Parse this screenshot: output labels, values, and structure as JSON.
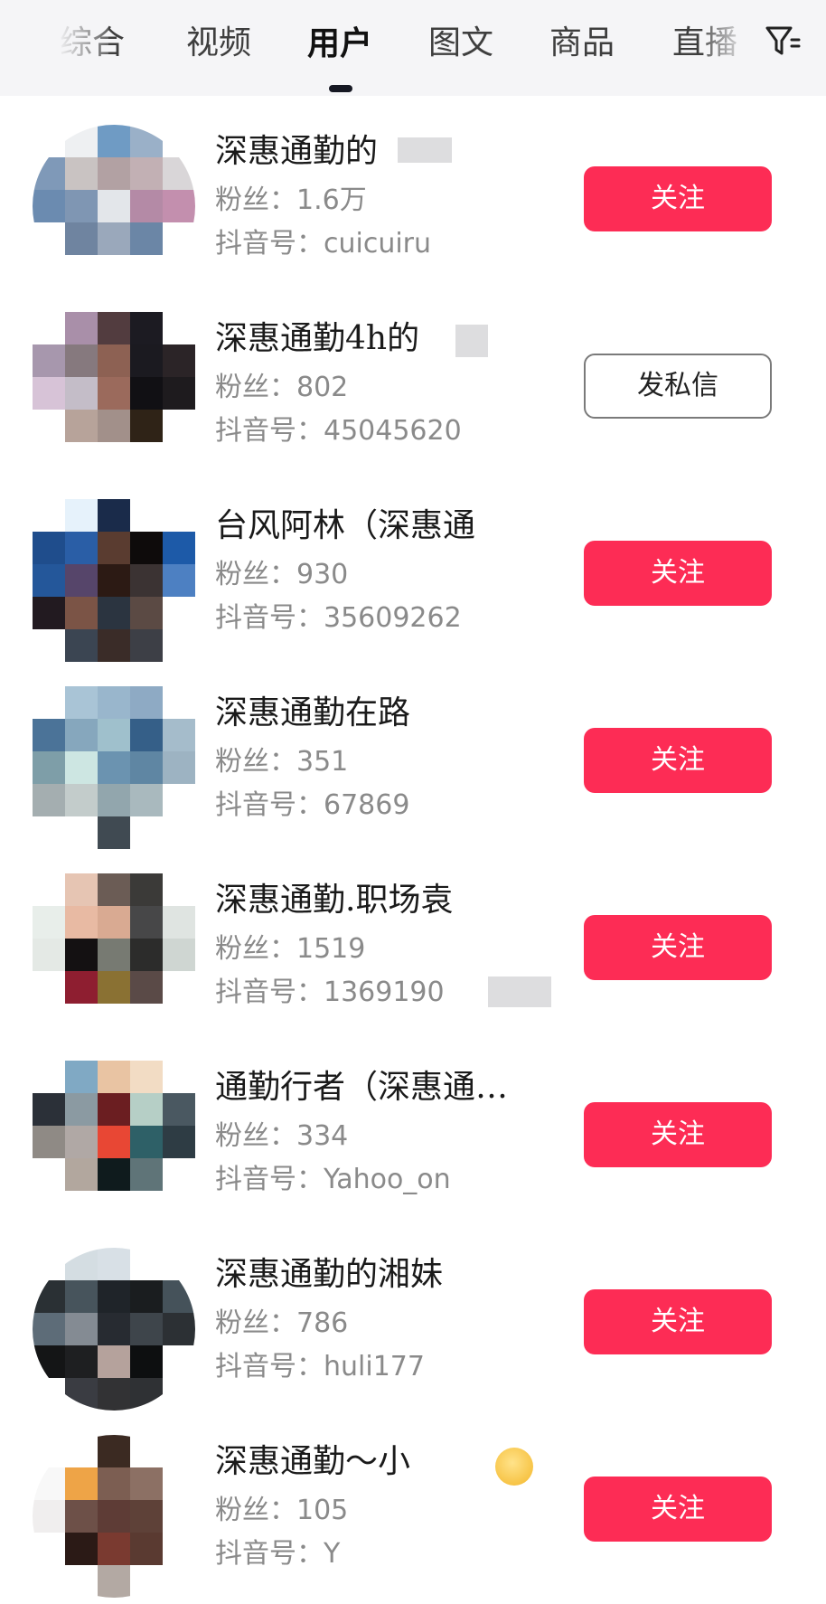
{
  "tabs": [
    {
      "label": "综合",
      "active": false
    },
    {
      "label": "视频",
      "active": false
    },
    {
      "label": "用户",
      "active": true
    },
    {
      "label": "图文",
      "active": false
    },
    {
      "label": "商品",
      "active": false
    },
    {
      "label": "直播",
      "active": false
    }
  ],
  "filter_icon": "filter-icon",
  "colors": {
    "follow_button": "#fd2c55",
    "topbar_bg": "#f5f5f7",
    "meta_text": "#8a8a8a"
  },
  "fans_label": "粉丝：",
  "douyin_label": "抖音号：",
  "users": [
    {
      "name": "深惠通勤的",
      "fans": "1.6万",
      "douyin_id": "cuicuiru",
      "button": "关注",
      "button_type": "follow"
    },
    {
      "name": "深惠通勤4h的",
      "fans": "802",
      "douyin_id": "45045620",
      "button": "发私信",
      "button_type": "message"
    },
    {
      "name": "台风阿林（深惠通",
      "fans": "930",
      "douyin_id": "35609262",
      "button": "关注",
      "button_type": "follow"
    },
    {
      "name": "深惠通勤在路",
      "fans": "351",
      "douyin_id": "67869",
      "button": "关注",
      "button_type": "follow"
    },
    {
      "name": "深惠通勤.职场袁",
      "fans": "1519",
      "douyin_id": "1369190",
      "button": "关注",
      "button_type": "follow"
    },
    {
      "name": "通勤行者（深惠通…",
      "fans": "334",
      "douyin_id": "Yahoo_on",
      "button": "关注",
      "button_type": "follow"
    },
    {
      "name": "深惠通勤的湘妹",
      "fans": "786",
      "douyin_id": "huli177",
      "button": "关注",
      "button_type": "follow"
    },
    {
      "name": "深惠通勤～小",
      "fans": "105",
      "douyin_id": "Y",
      "button": "关注",
      "button_type": "follow"
    }
  ]
}
